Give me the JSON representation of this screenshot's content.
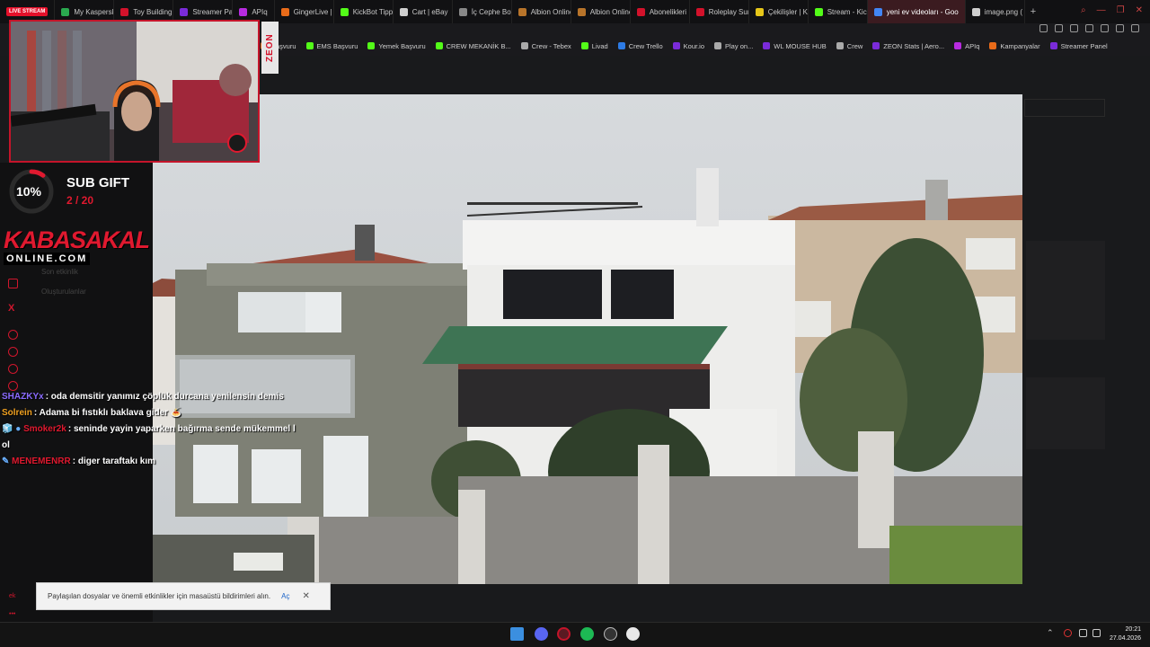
{
  "tabs": [
    {
      "label": "LIVE STREAM",
      "badge": true
    },
    {
      "label": "My Kaspersk",
      "color": "#2aa94f"
    },
    {
      "label": "Toy Building",
      "color": "#d3122b"
    },
    {
      "label": "Streamer Par",
      "color": "#7a2bd9"
    },
    {
      "label": "APIq",
      "color": "#b82be0"
    },
    {
      "label": "GingerLive |",
      "color": "#e96b19"
    },
    {
      "label": "KickBot Tipp",
      "color": "#53fc18"
    },
    {
      "label": "Cart | eBay",
      "color": "#cfcfcf"
    },
    {
      "label": "İç Cephe Boy",
      "color": "#888"
    },
    {
      "label": "Albion Online",
      "color": "#b8742a"
    },
    {
      "label": "Albion Online",
      "color": "#b8742a"
    },
    {
      "label": "Abonelikleri",
      "color": "#d3122b"
    },
    {
      "label": "Roleplay Sun",
      "color": "#d3122b"
    },
    {
      "label": "Çekilişler | K",
      "color": "#e6c619"
    },
    {
      "label": "Stream - Kick",
      "color": "#53fc18"
    },
    {
      "label": "yeni ev videoları - Goo",
      "color": "#4285f4",
      "active": true
    },
    {
      "label": "image.png (",
      "color": "#cfcfcf"
    }
  ],
  "bookmarks": [
    {
      "label": "Başvuru",
      "color": "#e96b19"
    },
    {
      "label": "EMS Başvuru",
      "color": "#53fc18"
    },
    {
      "label": "Yemek Başvuru",
      "color": "#53fc18"
    },
    {
      "label": "CREW MEKANİK B...",
      "color": "#53fc18"
    },
    {
      "label": "Crew - Tebex",
      "color": "#aaa"
    },
    {
      "label": "Livad",
      "color": "#53fc18"
    },
    {
      "label": "Crew Trello",
      "color": "#2d7be5"
    },
    {
      "label": "Kour.io",
      "color": "#7a2bd9"
    },
    {
      "label": "Play on...",
      "color": "#aaa"
    },
    {
      "label": "WL MOUSE HUB",
      "color": "#7a2bd9"
    },
    {
      "label": "Crew",
      "color": "#aaa"
    },
    {
      "label": "ZEON Stats | Aero...",
      "color": "#7a2bd9"
    },
    {
      "label": "APIq",
      "color": "#b82be0"
    },
    {
      "label": "Kampanyalar",
      "color": "#e96b19"
    },
    {
      "label": "Streamer Panel",
      "color": "#7a2bd9"
    }
  ],
  "webcam": {
    "brand": "ZEON",
    "mic_label": "RØDE"
  },
  "subgift": {
    "progress_text": "10%",
    "progress": 0.1,
    "title": "SUB GIFT",
    "count": "2 / 20"
  },
  "logo": {
    "top": "KABASAKAL",
    "bottom": "ONLINE.COM"
  },
  "chat": [
    {
      "user": "SHAZKYx",
      "color": "#8a6bff",
      "message": ": oda demsitir yanımız çöplük durcana yenilensin demis",
      "prefix": ""
    },
    {
      "user": "Solrein",
      "color": "#f0a020",
      "message": ": Adama bi fıstıklı baklava gider 🍝",
      "prefix": ""
    },
    {
      "user": "Smoker2k",
      "color": "#e0192f",
      "message": ": seninde yayin yaparken bağırma sende mükemmel l",
      "prefix": "🧊 ●",
      "cont": "ol"
    },
    {
      "user": "MENEMENRR",
      "color": "#e0192f",
      "message": ": diger taraftakı kım",
      "prefix": "✎"
    }
  ],
  "notification": {
    "text": "Paylaşılan dosyalar ve önemli etkinlikler için masaüstü bildirimleri alın.",
    "link": "Aç",
    "close": "✕"
  },
  "clock": {
    "time": "20:21",
    "date": "27.04.2026"
  },
  "colors": {
    "accent": "#e0192f",
    "taskbar": "#141414"
  }
}
